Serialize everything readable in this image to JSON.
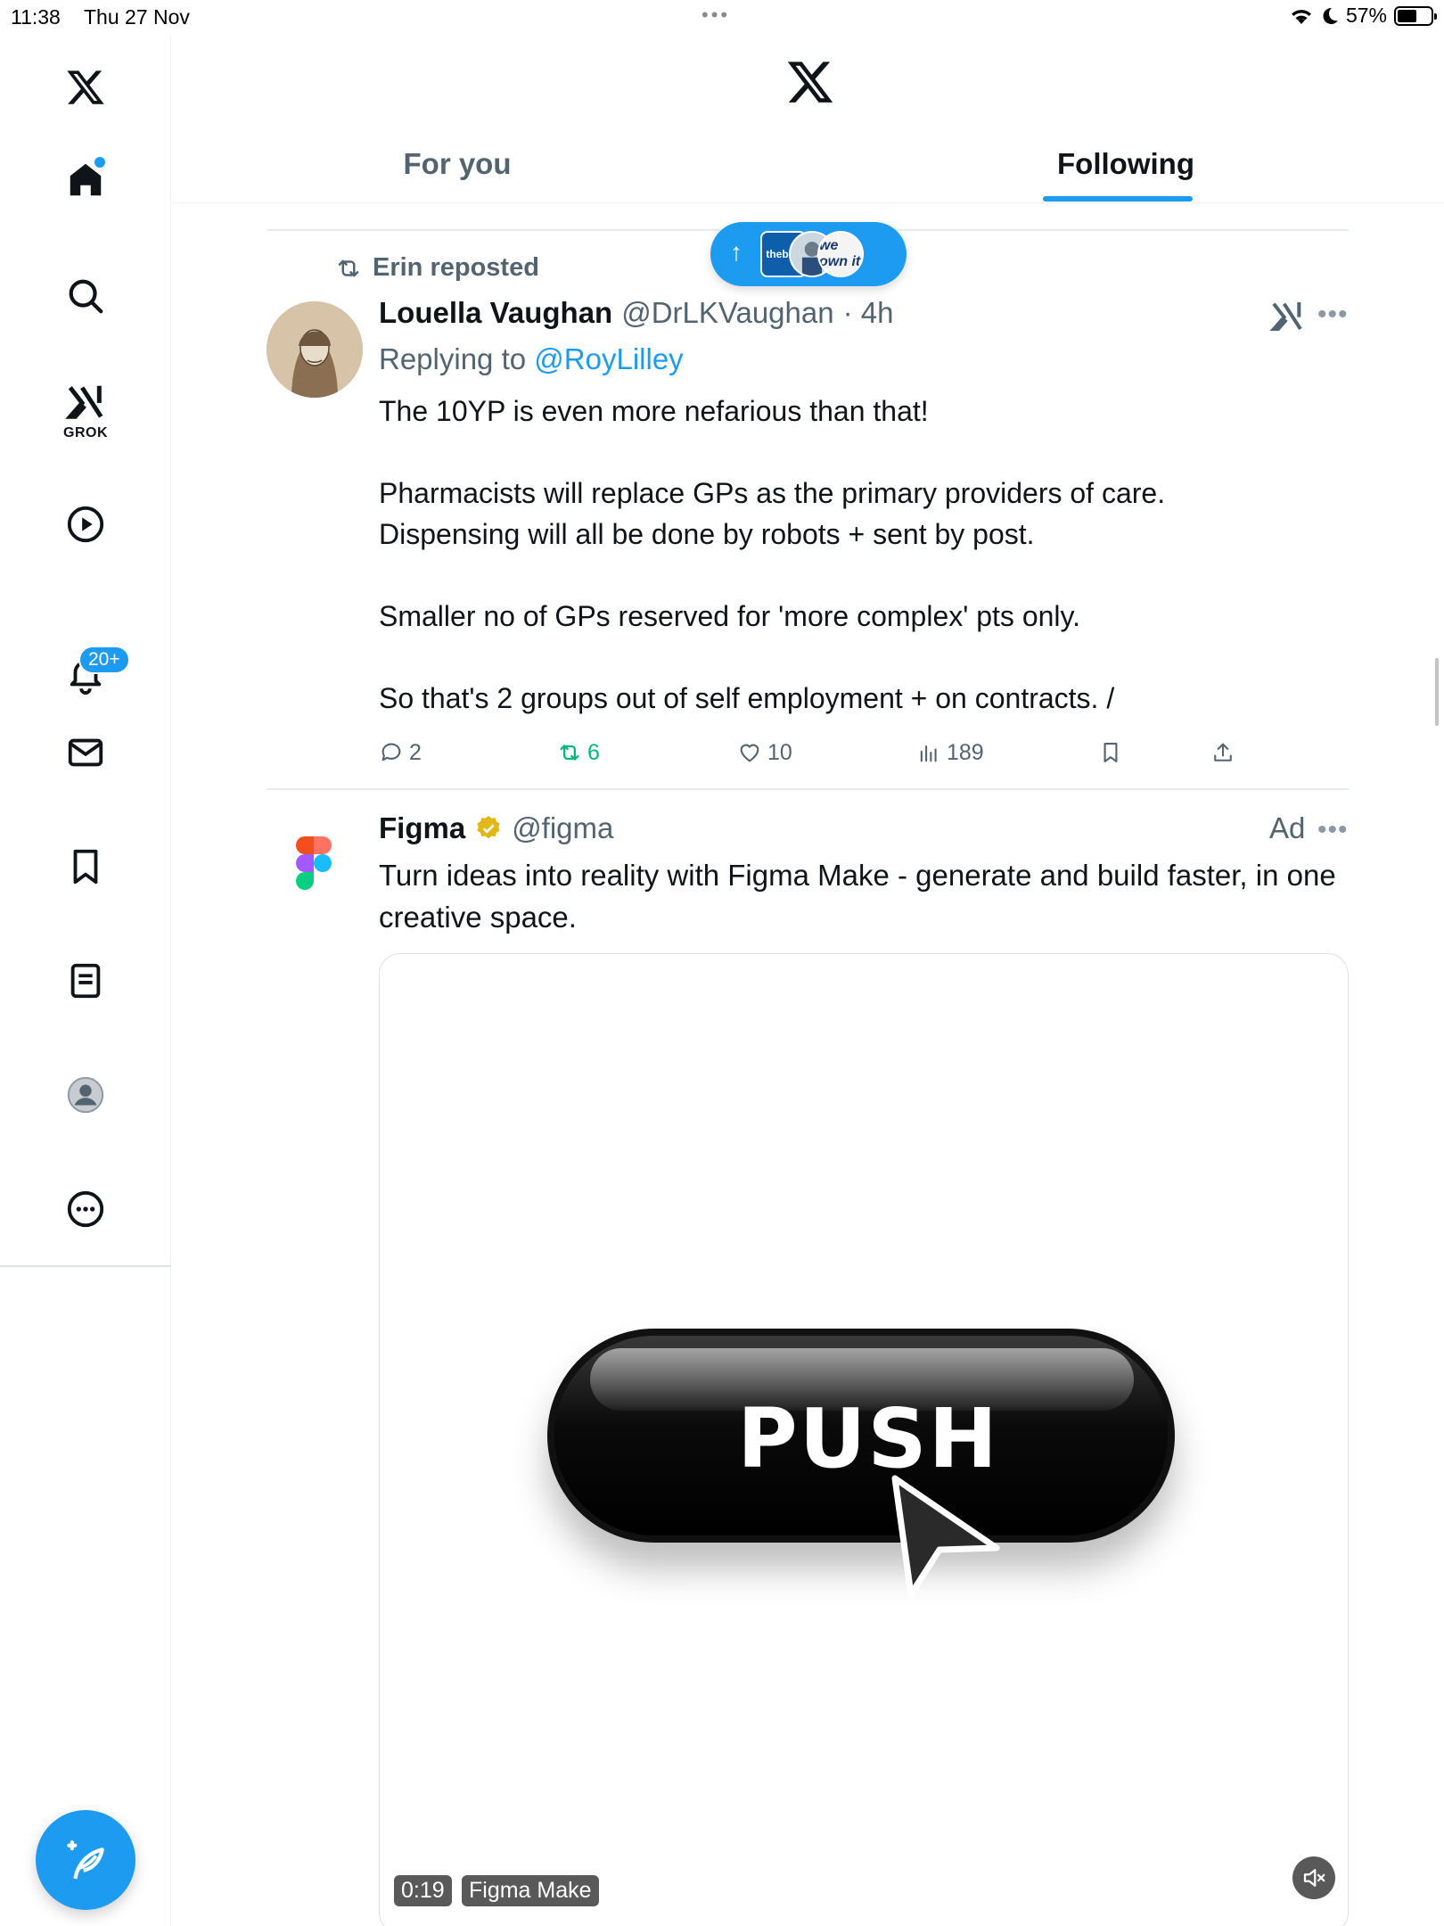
{
  "status_bar": {
    "time": "11:38",
    "date": "Thu 27 Nov",
    "battery": "57%",
    "battery_level": 0.57
  },
  "sidebar": {
    "grok_label": "GROK",
    "notifications_badge": "20+",
    "items": [
      "X logo",
      "Home",
      "Search",
      "Grok",
      "Video",
      "Notifications",
      "Messages",
      "Bookmarks",
      "Lists",
      "Profile",
      "More"
    ]
  },
  "header": {
    "tabs": [
      {
        "label": "For you",
        "selected": false
      },
      {
        "label": "Following",
        "selected": true
      }
    ]
  },
  "new_posts_pill": {
    "arrow": "↑",
    "avatars": [
      "thebmj",
      "",
      "we own it"
    ]
  },
  "post1": {
    "repost_by": "Erin reposted",
    "author_name": "Louella Vaughan",
    "author_handle": "@DrLKVaughan",
    "time": "· 4h",
    "replying_label": "Replying to",
    "replying_to": "@RoyLilley",
    "body": [
      "The 10YP is even more nefarious than that!",
      "",
      "Pharmacists will replace GPs as the primary providers of care.",
      "Dispensing will all be done by robots + sent by post.",
      "",
      "Smaller no of GPs reserved for 'more complex' pts only.",
      "",
      "So that's 2 groups out of self employment + on contracts. /"
    ],
    "replies": "2",
    "reposts": "6",
    "likes": "10",
    "views": "189"
  },
  "post2": {
    "author_name": "Figma",
    "author_handle": "@figma",
    "ad_label": "Ad",
    "body": "Turn ideas into reality with Figma Make - generate and build faster, in one creative space.",
    "media": {
      "button_text": "PUSH",
      "duration": "0:19",
      "title": "Figma Make"
    }
  },
  "colors": {
    "accent": "#1d9bf0",
    "repost_green": "#00ba7c",
    "secondary_text": "#536471"
  }
}
